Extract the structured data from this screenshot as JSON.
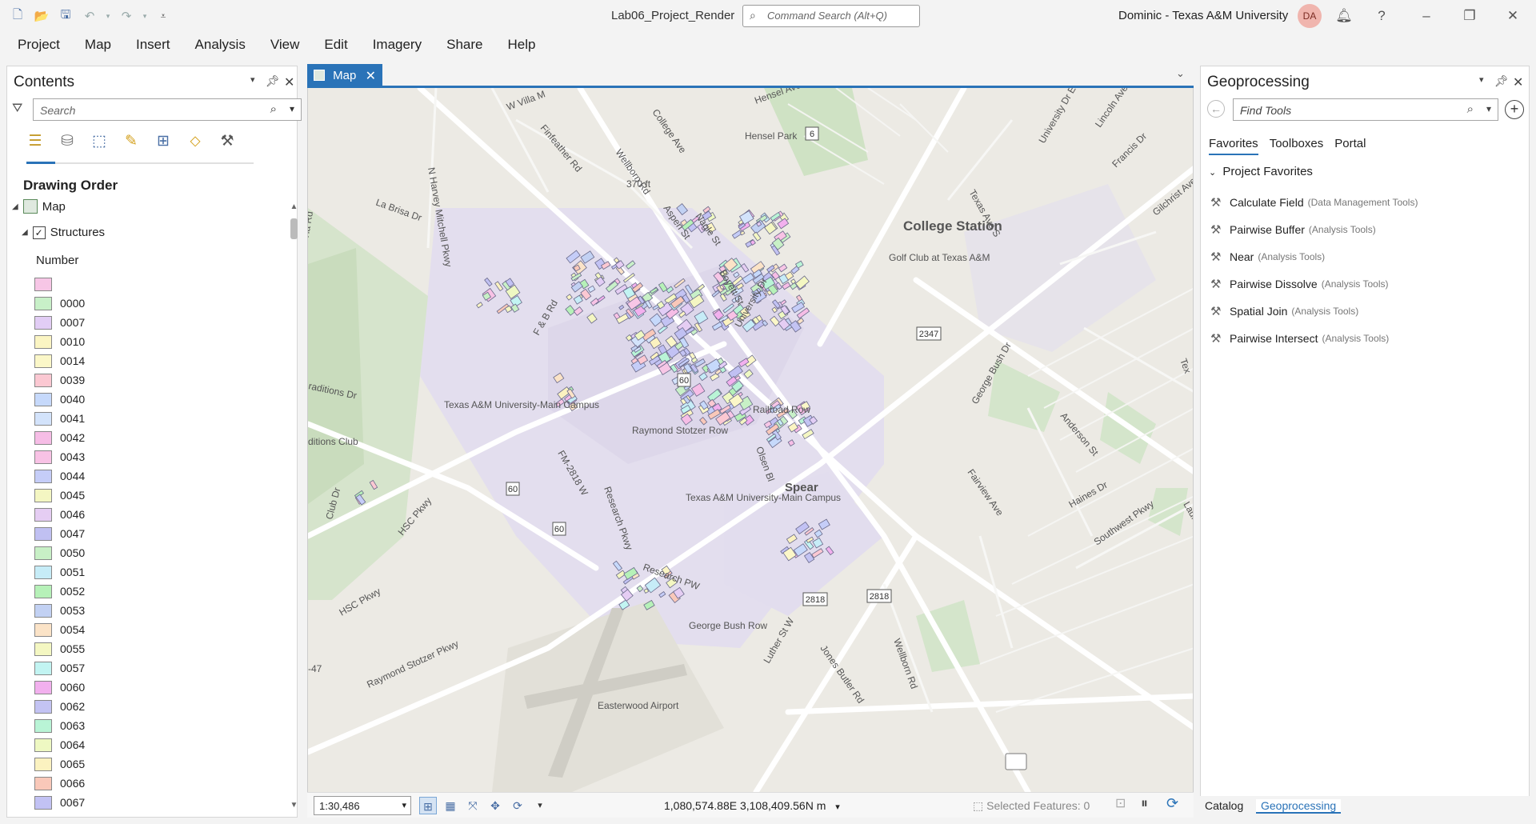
{
  "window": {
    "title": "Lab06_Project_Render",
    "command_search_placeholder": "Command Search (Alt+Q)",
    "user": "Dominic - Texas A&M University",
    "avatar_initials": "DA"
  },
  "menu": [
    "Project",
    "Map",
    "Insert",
    "Analysis",
    "View",
    "Edit",
    "Imagery",
    "Share",
    "Help"
  ],
  "contents": {
    "title": "Contents",
    "search_placeholder": "Search",
    "section": "Drawing Order",
    "map_layer": "Map",
    "layer": "Structures",
    "field": "Number",
    "legend": [
      {
        "label": "",
        "color": "#f7c6e6"
      },
      {
        "label": "0000",
        "color": "#c8f0c8"
      },
      {
        "label": "0007",
        "color": "#e2cdf5"
      },
      {
        "label": "0010",
        "color": "#fbf5c3"
      },
      {
        "label": "0014",
        "color": "#fbf7c8"
      },
      {
        "label": "0039",
        "color": "#fbc8d2"
      },
      {
        "label": "0040",
        "color": "#c6d9fb"
      },
      {
        "label": "0041",
        "color": "#d3e3fb"
      },
      {
        "label": "0042",
        "color": "#f6bde6"
      },
      {
        "label": "0043",
        "color": "#f8c2e5"
      },
      {
        "label": "0044",
        "color": "#c5cdf8"
      },
      {
        "label": "0045",
        "color": "#f4f6c2"
      },
      {
        "label": "0046",
        "color": "#e5cdf3"
      },
      {
        "label": "0047",
        "color": "#c0c0f2"
      },
      {
        "label": "0050",
        "color": "#c8f0c6"
      },
      {
        "label": "0051",
        "color": "#c6ecf7"
      },
      {
        "label": "0052",
        "color": "#b6f1b8"
      },
      {
        "label": "0053",
        "color": "#c2d1f3"
      },
      {
        "label": "0054",
        "color": "#fbe3c7"
      },
      {
        "label": "0055",
        "color": "#f4f7c2"
      },
      {
        "label": "0057",
        "color": "#c2f4f2"
      },
      {
        "label": "0060",
        "color": "#f2b0ee"
      },
      {
        "label": "0062",
        "color": "#c3c3f3"
      },
      {
        "label": "0063",
        "color": "#b9f4d6"
      },
      {
        "label": "0064",
        "color": "#eef8c2"
      },
      {
        "label": "0065",
        "color": "#fbf2c0"
      },
      {
        "label": "0066",
        "color": "#f9c8b9"
      },
      {
        "label": "0067",
        "color": "#c2c2f4"
      }
    ]
  },
  "map": {
    "tab": "Map",
    "labels": [
      "College Station",
      "Golf Club at Texas A&M",
      "Texas A&M University-Main Campus",
      "Texas A&M University-Main Campus",
      "Raymond Stotzer Row",
      "Spear",
      "Railroad Row",
      "George Bush Row",
      "Easterwood Airport",
      "Hensel Park",
      "370 ft",
      "raditions Dr",
      "ditions Club",
      "La Brisa Dr",
      "N Harvey Mitchell Pkwy",
      "Finfeather Rd",
      "Wellborn Rd",
      "Aspen St",
      "Nagle St",
      "Boyett St",
      "University Dr",
      "Texas Ave S",
      "George Bush Dr",
      "Fairview Ave",
      "Anderson St",
      "Haines Dr",
      "Southwest Pkwy",
      "Research Pkwy",
      "Research PW",
      "HSC Pkwy",
      "HSC Pkwy",
      "Raymond Stotzer Pkwy",
      "FM-2818 W",
      "Luther St W",
      "Jones Butler Rd",
      "Wellborn Rd",
      "F & B Rd",
      "Olsen Bl",
      "Club Dr",
      "Francis Dr",
      "Gilchrist Ave",
      "Lincoln Ave",
      "Hensel Ave",
      "College Ave",
      "W Villa M",
      "University Dr E",
      "Laura",
      "Tex",
      "Via Rd",
      "-47"
    ],
    "shields": [
      "6",
      "2347",
      "60",
      "60",
      "60",
      "2818",
      "2818"
    ]
  },
  "status": {
    "scale": "1:30,486",
    "coordinates": "1,080,574.88E 3,108,409.56N m",
    "selected_features": "Selected Features: 0"
  },
  "geoprocessing": {
    "title": "Geoprocessing",
    "search_placeholder": "Find Tools",
    "tabs": [
      "Favorites",
      "Toolboxes",
      "Portal"
    ],
    "section": "Project Favorites",
    "tools": [
      {
        "name": "Calculate Field",
        "category": "(Data Management Tools)"
      },
      {
        "name": "Pairwise Buffer",
        "category": "(Analysis Tools)"
      },
      {
        "name": "Near",
        "category": "(Analysis Tools)"
      },
      {
        "name": "Pairwise Dissolve",
        "category": "(Analysis Tools)"
      },
      {
        "name": "Spatial Join",
        "category": "(Analysis Tools)"
      },
      {
        "name": "Pairwise Intersect",
        "category": "(Analysis Tools)"
      }
    ]
  },
  "bottom_tabs": [
    "Catalog",
    "Geoprocessing"
  ]
}
